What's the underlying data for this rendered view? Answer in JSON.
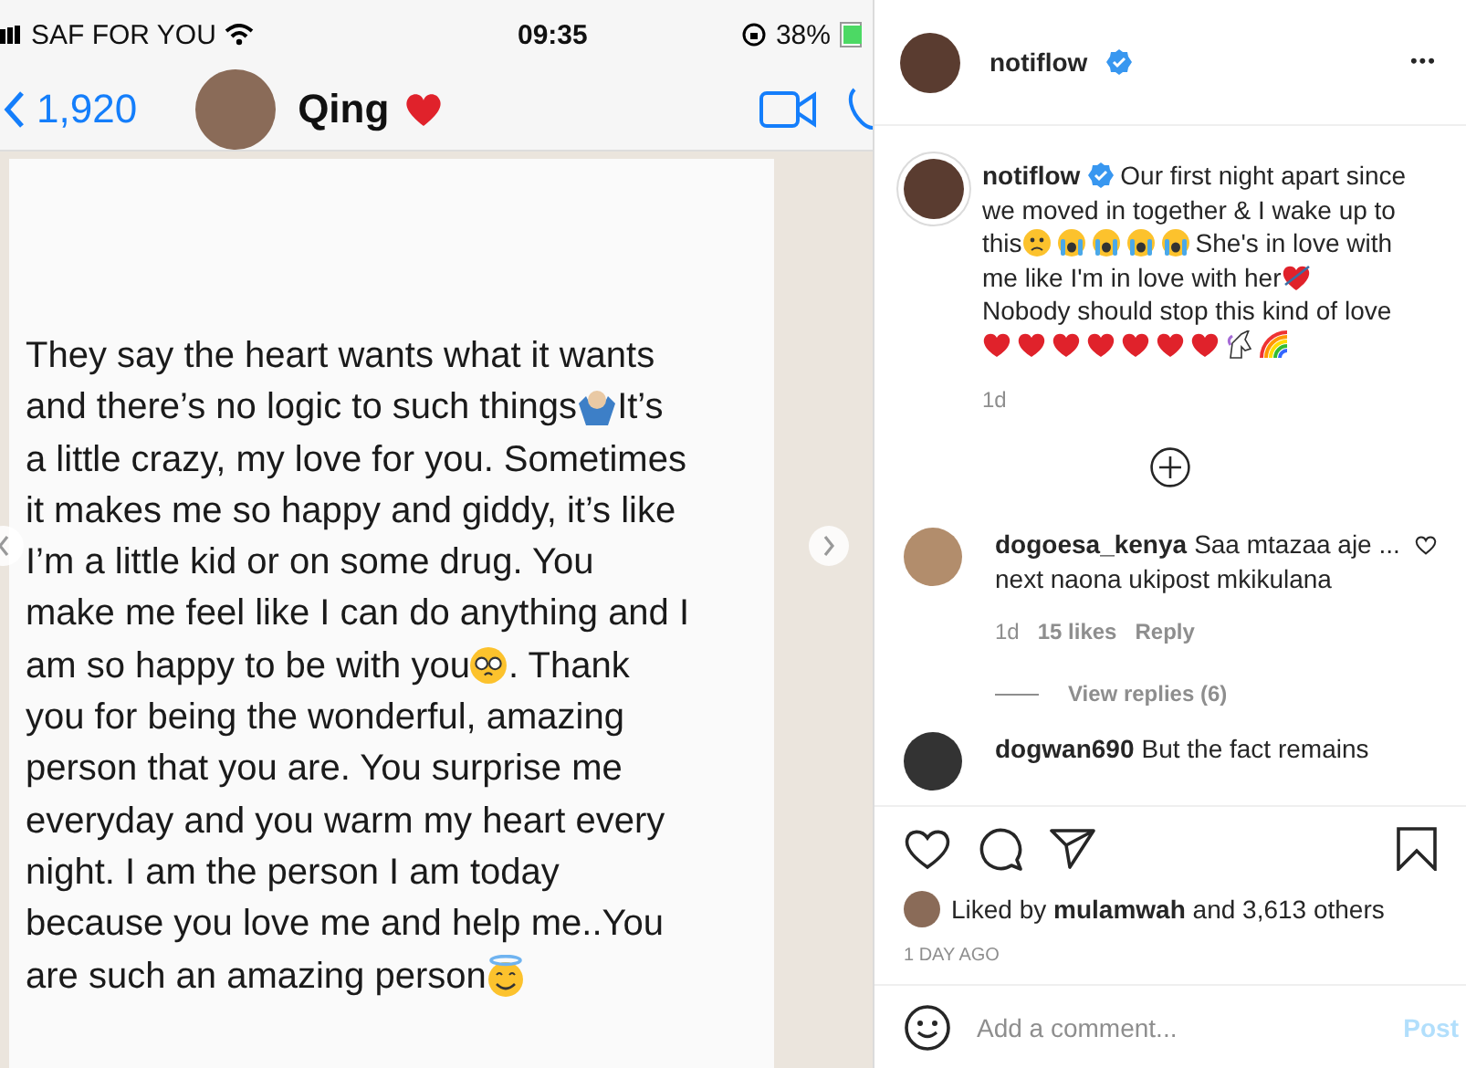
{
  "chat_screenshot": {
    "status_bar": {
      "carrier": "SAF FOR YOU",
      "time": "09:35",
      "battery": "38%"
    },
    "header": {
      "back_count": "1,920",
      "contact": "Qing"
    },
    "message_lines": [
      [
        {
          "kind": "text",
          "text": "They say the heart wants what it wants"
        }
      ],
      [
        {
          "kind": "text",
          "text": "and there’s no logic to such things"
        },
        {
          "kind": "shrug"
        },
        {
          "kind": "text",
          "text": " It’s"
        }
      ],
      [
        {
          "kind": "text",
          "text": "a little crazy, my love for you. Sometimes"
        }
      ],
      [
        {
          "kind": "text",
          "text": "it makes me so happy and giddy, it’s like"
        }
      ],
      [
        {
          "kind": "text",
          "text": "I’m a little kid or on some drug. You"
        }
      ],
      [
        {
          "kind": "text",
          "text": "make me feel like I can do anything and I"
        }
      ],
      [
        {
          "kind": "text",
          "text": "am so happy to be with you"
        },
        {
          "kind": "pleading"
        },
        {
          "kind": "text",
          "text": ". Thank"
        }
      ],
      [
        {
          "kind": "text",
          "text": "you for being the wonderful, amazing"
        }
      ],
      [
        {
          "kind": "text",
          "text": "person that you are. You surprise me"
        }
      ],
      [
        {
          "kind": "text",
          "text": "everyday and you warm my heart every"
        }
      ],
      [
        {
          "kind": "text",
          "text": "night. I am the person I am today"
        }
      ],
      [
        {
          "kind": "text",
          "text": "because you love me and help me..You"
        }
      ],
      [
        {
          "kind": "text",
          "text": "are such an amazing person"
        },
        {
          "kind": "halo"
        }
      ]
    ]
  },
  "post": {
    "username": "notiflow",
    "more": "•••",
    "caption_username": "notiflow",
    "caption_lines": [
      [
        {
          "kind": "text",
          "text": "Our first night apart since"
        }
      ],
      [
        {
          "kind": "text",
          "text": "we moved in together & I wake up to"
        }
      ],
      [
        {
          "kind": "text",
          "text": "this "
        },
        {
          "kind": "frown"
        },
        {
          "kind": "crying"
        },
        {
          "kind": "crying"
        },
        {
          "kind": "crying"
        },
        {
          "kind": "crying"
        },
        {
          "kind": "text",
          "text": " She's in love with"
        }
      ],
      [
        {
          "kind": "text",
          "text": "me like I'm in love with her "
        },
        {
          "kind": "heart-arrow"
        }
      ],
      [
        {
          "kind": "text",
          "text": "Nobody should stop this kind of love"
        }
      ],
      [
        {
          "kind": "heart"
        },
        {
          "kind": "heart"
        },
        {
          "kind": "heart"
        },
        {
          "kind": "heart"
        },
        {
          "kind": "heart"
        },
        {
          "kind": "heart"
        },
        {
          "kind": "heart"
        },
        {
          "kind": "unicorn"
        },
        {
          "kind": "rainbow"
        }
      ]
    ],
    "caption_age": "1d",
    "comments": [
      {
        "username": "dogoesa_kenya",
        "lines": [
          "Saa mtazaa aje ...",
          "next naona ukipost mkikulana"
        ],
        "age": "1d",
        "likes": "15 likes",
        "reply": "Reply",
        "view_replies": "View replies (6)"
      },
      {
        "username": "dogwan690",
        "lines": [
          "But the fact remains"
        ]
      }
    ],
    "likes": {
      "prefix": "Liked by",
      "user": "mulamwah",
      "rest": "and 3,613 others"
    },
    "date": "1 DAY AGO",
    "comment_field": {
      "placeholder": "Add a comment..."
    },
    "post_button": "Post"
  }
}
